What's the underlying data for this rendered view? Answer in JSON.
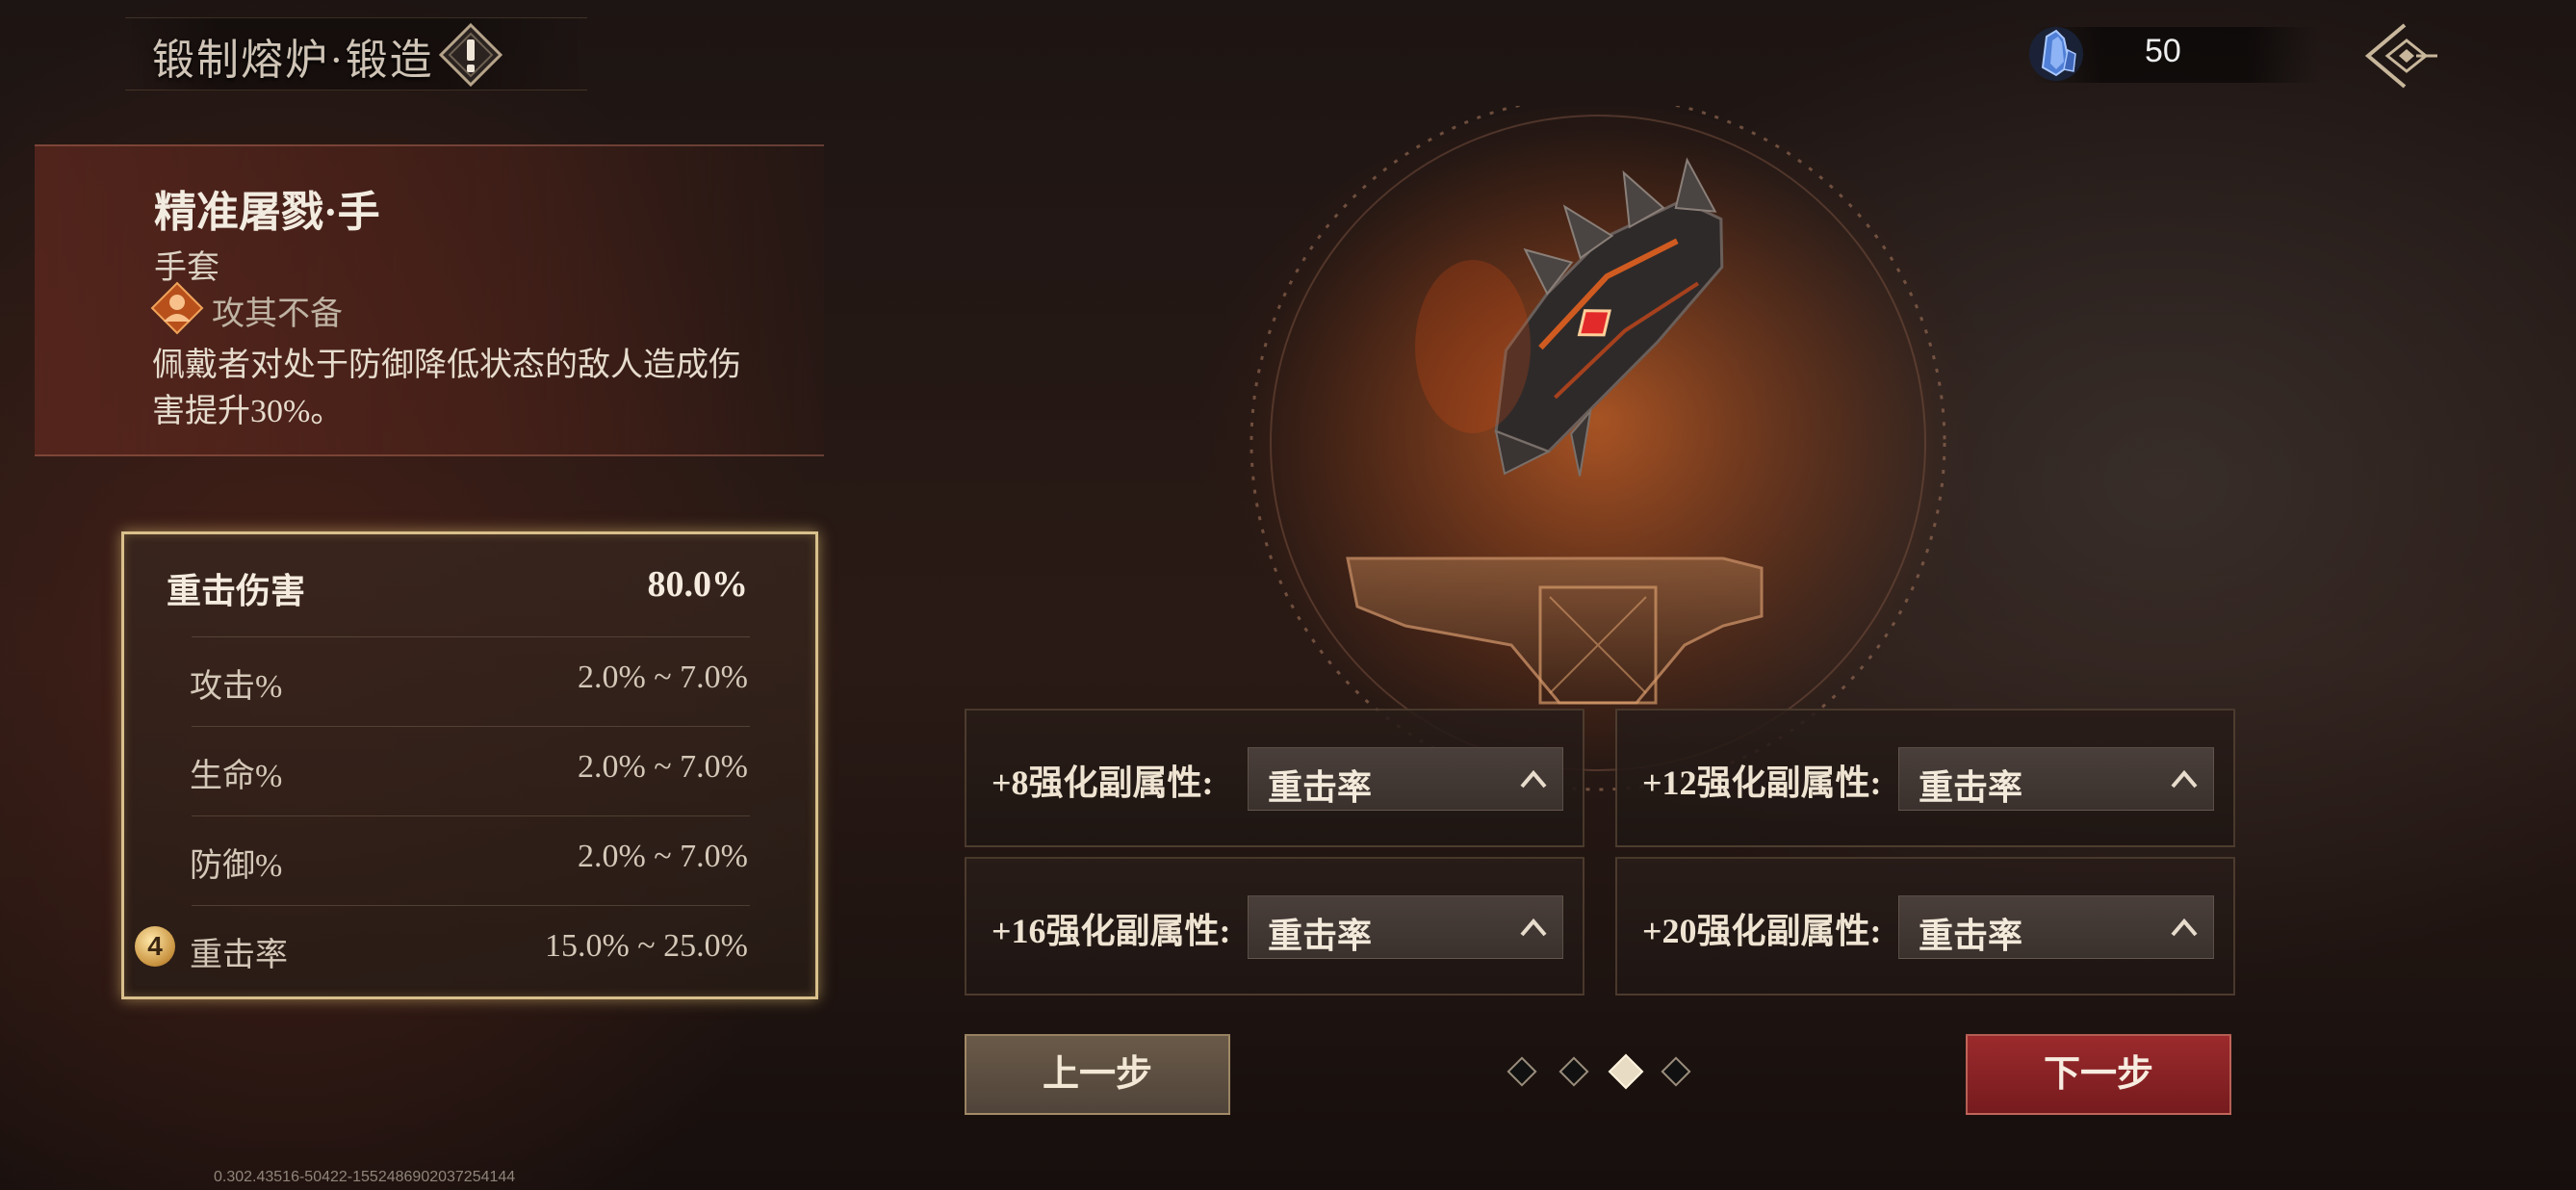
{
  "header": {
    "title": "锻制熔炉·锻造",
    "info_icon": "exclamation-diamond-icon",
    "currency": {
      "icon": "crystal-icon",
      "value": "50"
    },
    "back_icon": "back-arrow-icon"
  },
  "item": {
    "name": "精准屠戮·手",
    "type": "手套",
    "set_icon": "set-bonus-icon",
    "set_name": "攻其不备",
    "description": "佩戴者对处于防御降低状态的敌人造成伤害提升30%。"
  },
  "stats": {
    "main": {
      "label": "重击伤害",
      "value": "80.0%"
    },
    "subs": [
      {
        "label": "攻击%",
        "range": "2.0% ~ 7.0%"
      },
      {
        "label": "生命%",
        "range": "2.0% ~ 7.0%"
      },
      {
        "label": "防御%",
        "range": "2.0% ~ 7.0%"
      },
      {
        "label": "重击率",
        "range": "15.0% ~ 25.0%",
        "badge": "4"
      }
    ]
  },
  "sub_attributes": [
    {
      "label": "+8强化副属性:",
      "value": "重击率"
    },
    {
      "label": "+12强化副属性:",
      "value": "重击率"
    },
    {
      "label": "+16强化副属性:",
      "value": "重击率"
    },
    {
      "label": "+20强化副属性:",
      "value": "重击率"
    }
  ],
  "navigation": {
    "prev_label": "上一步",
    "next_label": "下一步",
    "steps_total": 4,
    "current_step": 3
  },
  "build_info": "0.302.43516-50422-1552486902037254144",
  "colors": {
    "accent_gold": "#d9c08c",
    "next_red": "#9b2a2c",
    "panel_red": "#5f281e"
  }
}
